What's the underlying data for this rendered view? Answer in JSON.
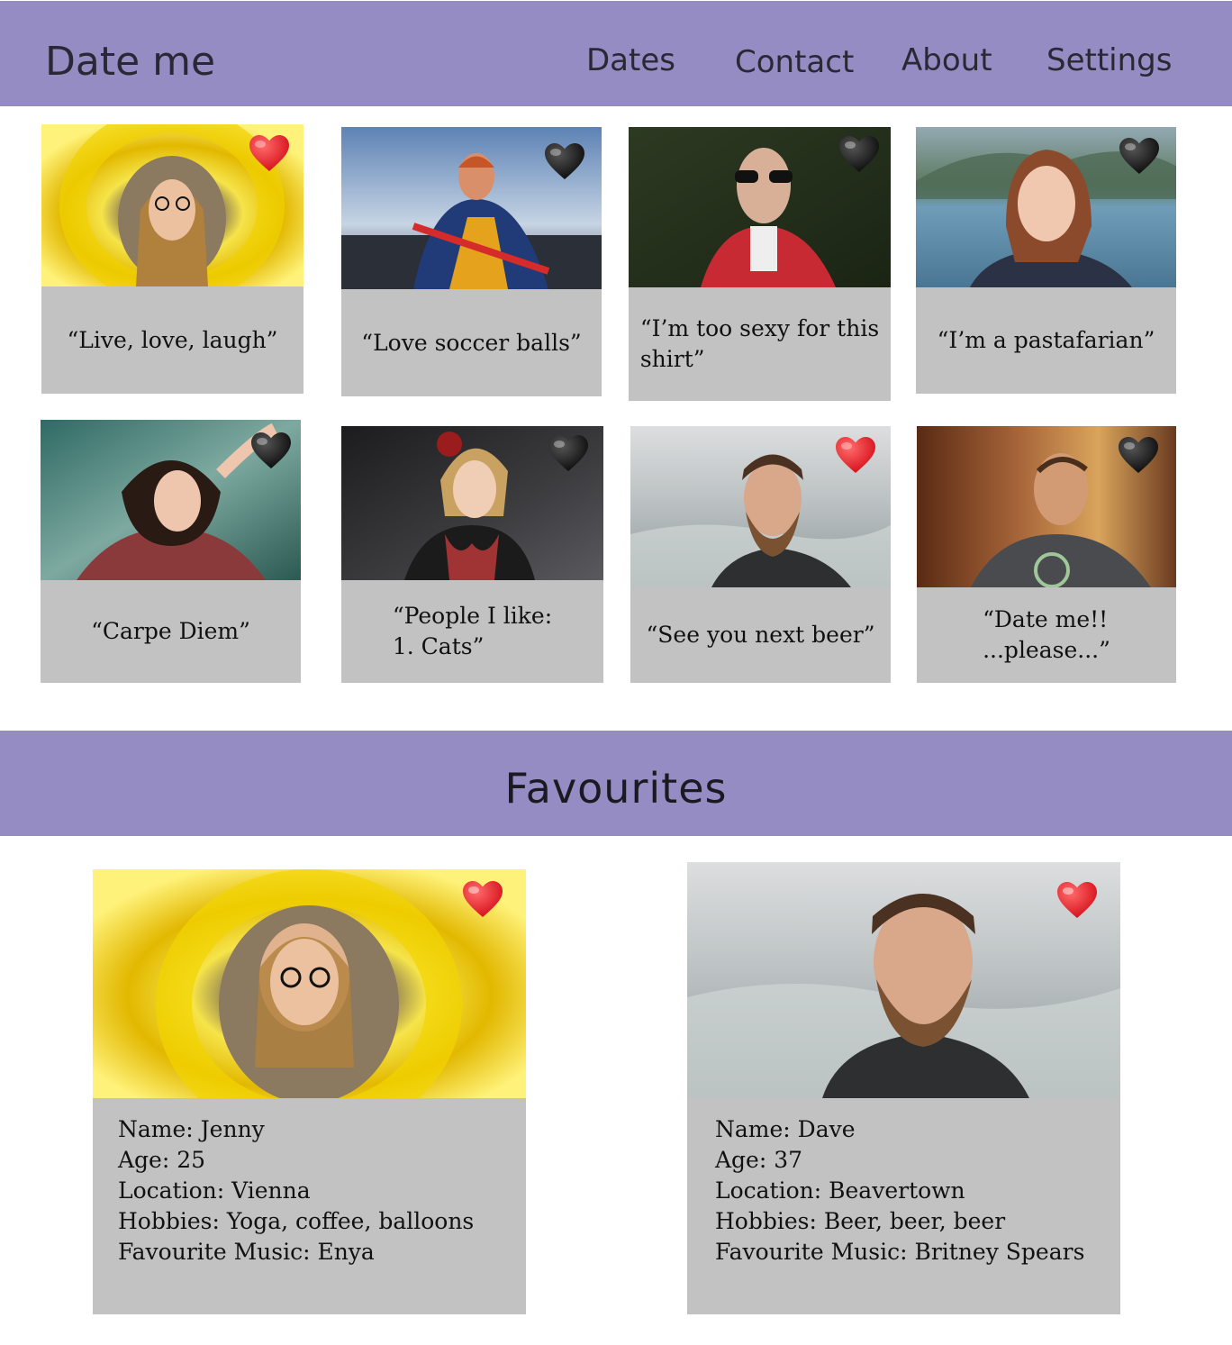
{
  "header": {
    "brand": "Date me",
    "nav": [
      "Dates",
      "Contact",
      "About",
      "Settings"
    ]
  },
  "dates": [
    {
      "quote": "“Live, love, laugh”",
      "favourite": true
    },
    {
      "quote": "“Love soccer balls”",
      "favourite": false
    },
    {
      "quote": "“I’m too sexy for this\nshirt”",
      "favourite": false
    },
    {
      "quote": "“I’m a pastafarian”",
      "favourite": false
    },
    {
      "quote": "“Carpe Diem”",
      "favourite": false
    },
    {
      "quote": "“People I like:\n1. Cats”",
      "favourite": false
    },
    {
      "quote": "“See you next beer”",
      "favourite": true
    },
    {
      "quote": "“Date me!!\n...please...”",
      "favourite": false
    }
  ],
  "favourites": {
    "title": "Favourites",
    "people": [
      {
        "name": "Name: Jenny",
        "age": "Age: 25",
        "location": "Location: Vienna",
        "hobbies": "Hobbies: Yoga, coffee, balloons",
        "music": "Favourite Music: Enya"
      },
      {
        "name": "Name: Dave",
        "age": "Age: 37",
        "location": "Location: Beavertown",
        "hobbies": "Hobbies: Beer, beer, beer",
        "music": "Favourite Music: Britney Spears"
      }
    ]
  },
  "colors": {
    "bar": "#958cc4",
    "card": "#c2c2c2",
    "heart_favourite": "#e8101c",
    "heart_other": "#151515"
  },
  "icons": {
    "favourite": "red-heart-icon",
    "other": "black-heart-icon"
  }
}
